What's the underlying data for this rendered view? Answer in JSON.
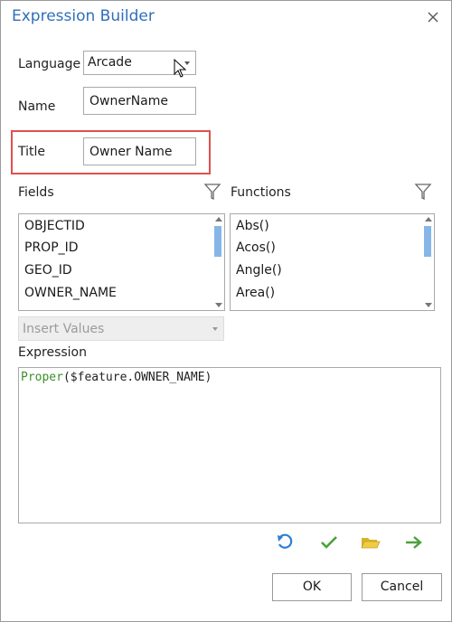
{
  "window": {
    "title": "Expression Builder"
  },
  "language": {
    "label": "Language",
    "value": "Arcade"
  },
  "name": {
    "label": "Name",
    "value": "OwnerName"
  },
  "title_field": {
    "label": "Title",
    "value": "Owner Name"
  },
  "fields": {
    "label": "Fields",
    "items": [
      "OBJECTID",
      "PROP_ID",
      "GEO_ID",
      "OWNER_NAME"
    ]
  },
  "functions": {
    "label": "Functions",
    "items": [
      "Abs()",
      "Acos()",
      "Angle()",
      "Area()"
    ]
  },
  "insert_values": {
    "value": "Insert Values"
  },
  "expression": {
    "label": "Expression",
    "func": "Proper",
    "open": "(",
    "var": "$feature",
    "rest": ".OWNER_NAME)"
  },
  "buttons": {
    "ok": "OK",
    "cancel": "Cancel"
  },
  "colors": {
    "title": "#2f6fba",
    "highlight": "#e0504f",
    "code_func": "#3a8f2a",
    "scroll_thumb": "#86b6e8"
  },
  "icons": [
    "close-icon",
    "filter-icon",
    "undo-icon",
    "check-icon",
    "open-folder-icon",
    "run-arrow-icon",
    "mouse-cursor-icon"
  ]
}
